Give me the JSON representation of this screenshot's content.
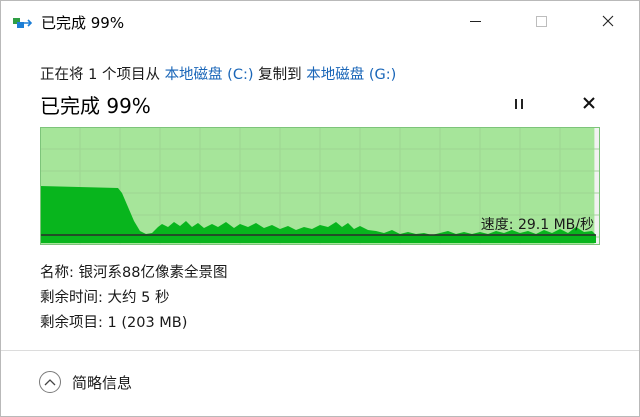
{
  "window": {
    "title": "已完成 99%",
    "minimize_label": "",
    "maximize_label": "",
    "close_label": ""
  },
  "copy": {
    "prefix": "正在将 1 个项目从 ",
    "source": "本地磁盘 (C:)",
    "middle": " 复制到 ",
    "dest": "本地磁盘 (G:)"
  },
  "status": {
    "big": "已完成 99%",
    "progress_percent": 99
  },
  "chart": {
    "speed_label": "速度: 29.1 MB/秒"
  },
  "details": {
    "name_label": "名称: ",
    "name_value": "银河系88亿像素全景图",
    "time_label": "剩余时间: ",
    "time_value": "大约 5 秒",
    "items_label": "剩余项目: ",
    "items_value": "1 (203 MB)"
  },
  "footer": {
    "less_info_label": "简略信息"
  },
  "colors": {
    "progress_fill": "#a6e59a",
    "progress_remaining": "#f2f2f2",
    "speed_area": "#08b51d",
    "border": "#7dc47a",
    "link": "#1a66b8"
  },
  "chart_data": {
    "type": "area",
    "ylabel": "",
    "xlabel": "",
    "title": "",
    "note": ""
  }
}
